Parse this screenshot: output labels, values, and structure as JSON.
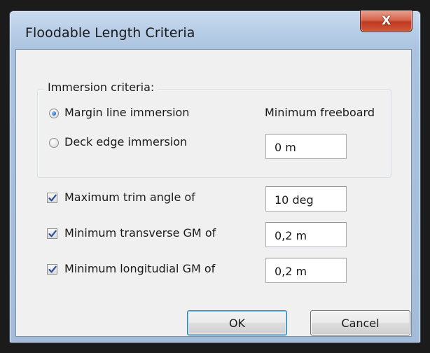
{
  "dialog": {
    "title": "Floodable Length Criteria",
    "close_label": "X"
  },
  "immersion": {
    "group_label": "Immersion criteria:",
    "options": [
      {
        "label": "Margin line immersion",
        "selected": true
      },
      {
        "label": "Deck edge immersion",
        "selected": false
      }
    ],
    "freeboard_label": "Minimum freeboard",
    "freeboard_value": "0 m"
  },
  "criteria": [
    {
      "label": "Maximum trim angle of",
      "checked": true,
      "value": "10 deg"
    },
    {
      "label": "Minimum transverse GM of",
      "checked": true,
      "value": "0,2 m"
    },
    {
      "label": "Minimum longitudial GM of",
      "checked": true,
      "value": "0,2 m"
    }
  ],
  "buttons": {
    "ok_label": "OK",
    "cancel_label": "Cancel"
  }
}
